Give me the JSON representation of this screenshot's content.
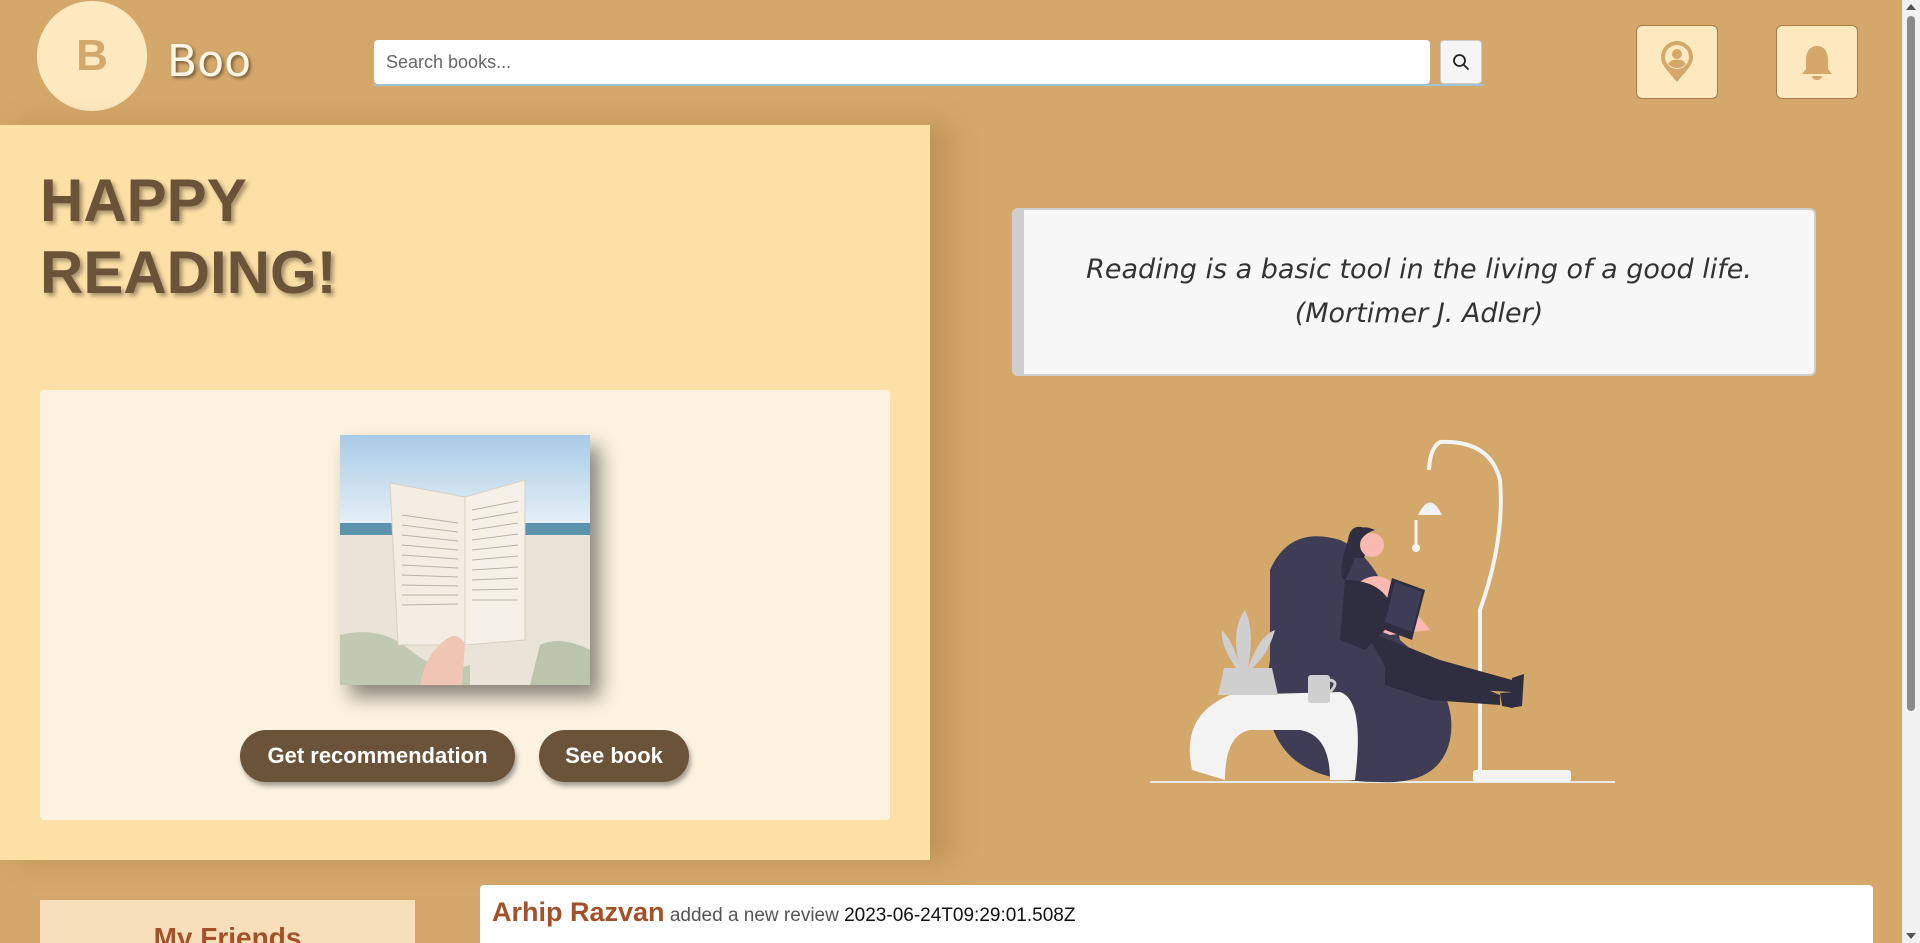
{
  "header": {
    "logo_letter": "B",
    "brand": "Boo",
    "search_placeholder": "Search books...",
    "search_icon": "search-icon",
    "location_icon": "location-user-icon",
    "bell_icon": "bell-icon"
  },
  "hero": {
    "title": "HAPPY READING!",
    "buttons": {
      "recommend": "Get recommendation",
      "see_book": "See book"
    }
  },
  "quote": {
    "text": "Reading is a basic tool in the living of a good life. (Mortimer J. Adler)"
  },
  "friends": {
    "title": "My Friends"
  },
  "feed": [
    {
      "user": "Arhip Razvan",
      "action": "added a new review",
      "timestamp": "2023-06-24T09:29:01.508Z"
    }
  ],
  "colors": {
    "background": "#d4a76a",
    "hero_bg": "#fde0a6",
    "card_bg": "#fdf2df",
    "button": "#6b5339",
    "accent_text": "#a4512a"
  }
}
